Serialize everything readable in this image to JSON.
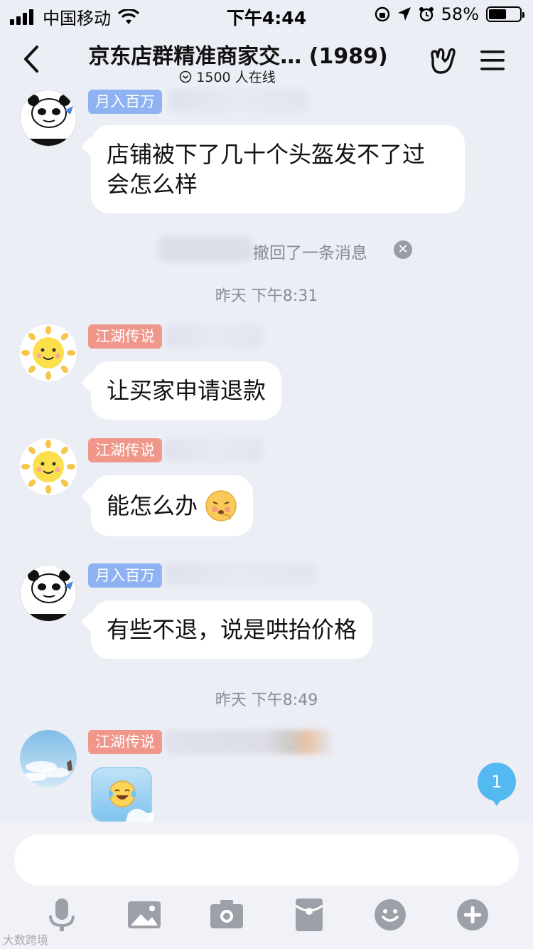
{
  "status_bar": {
    "carrier": "中国移动",
    "time": "下午4:44",
    "battery": "58%",
    "battery_level": 0.58
  },
  "header": {
    "title": "京东店群精准商家交… (1989)",
    "online": "1500 人在线",
    "icons": [
      "back-arrow-icon",
      "hand-gesture-icon",
      "menu-icon"
    ]
  },
  "messages": [
    {
      "tag": "月入百万",
      "tag_color": "#8fb3f2",
      "text_lines": [
        "店铺被下了几十个头盔发不了过",
        "会怎么样"
      ]
    },
    {
      "recall_text": "撤回了一条消息"
    },
    {
      "time": "昨天  下午8:31"
    },
    {
      "tag": "江湖传说",
      "tag_color": "#f0968a",
      "text": "让买家申请退款"
    },
    {
      "tag": "江湖传说",
      "tag_color": "#f0968a",
      "text": "能怎么办"
    },
    {
      "tag": "月入百万",
      "tag_color": "#8fb3f2",
      "text": "有些不退，说是哄抬价格"
    },
    {
      "time": "昨天  下午8:49"
    },
    {
      "tag": "江湖传说",
      "tag_color": "#f0968a",
      "sticker": "laughing-sticker"
    }
  ],
  "unread_count": "1",
  "input": {
    "placeholder": ""
  },
  "toolbar_icons": [
    "microphone-icon",
    "image-icon",
    "camera-icon",
    "red-packet-icon",
    "emoji-icon",
    "plus-icon"
  ],
  "watermark": "大数跨境"
}
